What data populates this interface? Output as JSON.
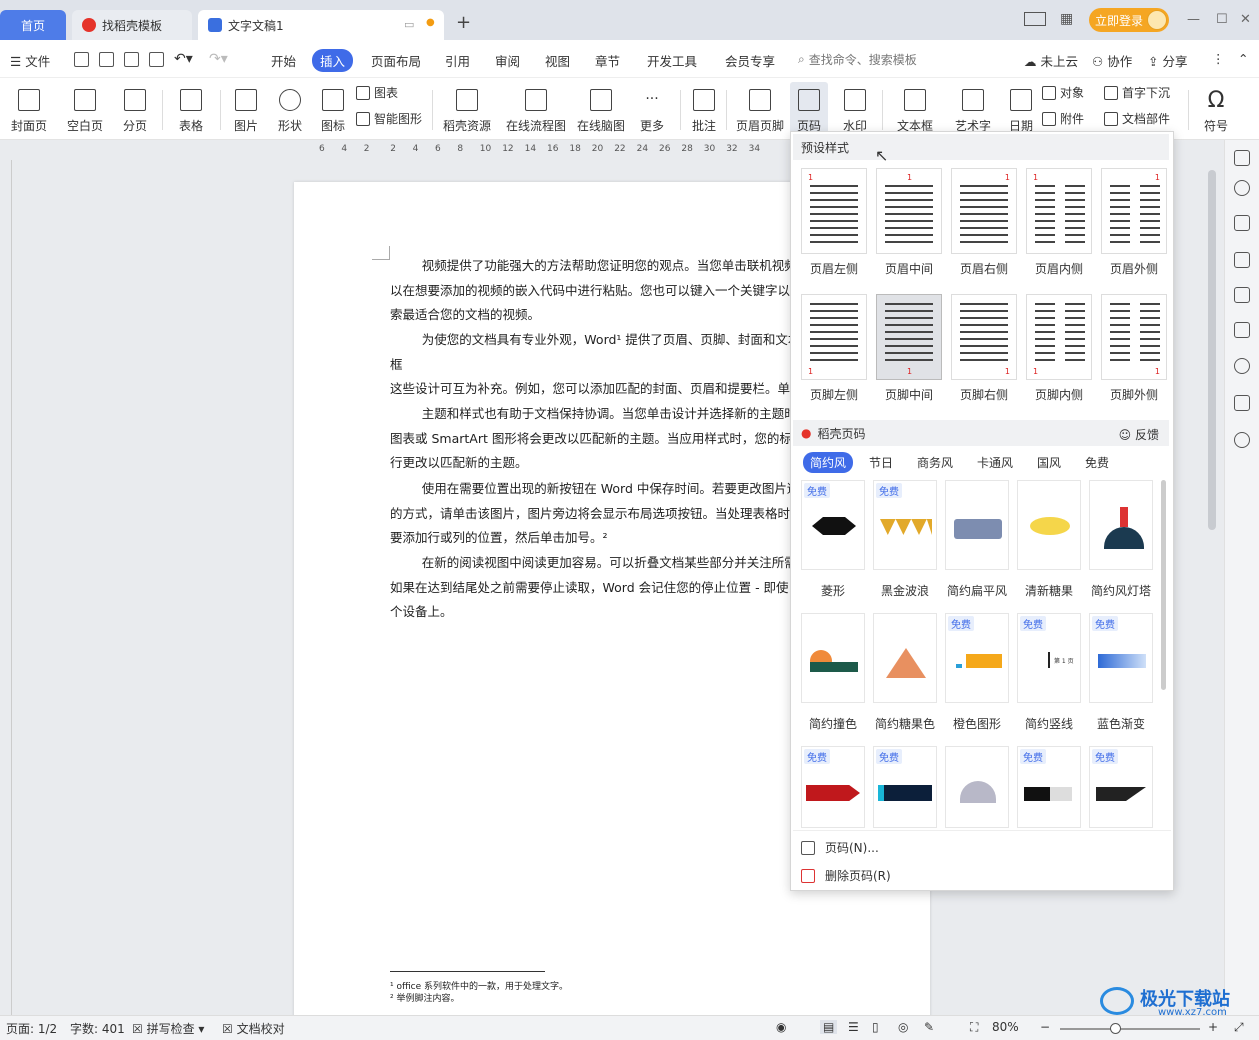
{
  "tabs": {
    "home": "首页",
    "template": "找稻壳模板",
    "doc": "文字文稿1"
  },
  "titlebar": {
    "login": "立即登录"
  },
  "menus": {
    "file": "文件",
    "items": [
      "开始",
      "插入",
      "页面布局",
      "引用",
      "审阅",
      "视图",
      "章节",
      "开发工具",
      "会员专享"
    ],
    "active": "插入",
    "search_placeholder": "查找命令、搜索模板",
    "cloud": "未上云",
    "collab": "协作",
    "share": "分享"
  },
  "toolbar": {
    "big": [
      "封面页",
      "空白页",
      "分页",
      "表格",
      "图片",
      "形状",
      "图标",
      "稻壳资源",
      "在线流程图",
      "在线脑图",
      "更多",
      "批注",
      "页眉页脚",
      "页码",
      "水印",
      "文本框",
      "艺术字",
      "日期",
      "符号"
    ],
    "small": {
      "chart": "图表",
      "smart": "智能图形",
      "object": "对象",
      "dropcap": "首字下沉",
      "attach": "附件",
      "docpart": "文档部件"
    }
  },
  "ruler": [
    "6",
    "4",
    "2",
    "2",
    "4",
    "6",
    "8",
    "10",
    "12",
    "14",
    "16",
    "18",
    "20",
    "22",
    "24",
    "26",
    "28",
    "30",
    "32",
    "34"
  ],
  "document": {
    "paragraphs": [
      "        视频提供了功能强大的方法帮助您证明您的观点。当您单击联机视频\n以在想要添加的视频的嵌入代码中进行粘贴。您也可以键入一个关键字以\n索最适合您的文档的视频。",
      "        为使您的文档具有专业外观，Word¹ 提供了页眉、页脚、封面和文本框\n这些设计可互为补充。例如，您可以添加匹配的封面、页眉和提要栏。单\n入”，然后从不同库中选择所需元素。",
      "        主题和样式也有助于文档保持协调。当您单击设计并选择新的主题时\n图表或 SmartArt 图形将会更改以匹配新的主题。当应用样式时，您的标\n行更改以匹配新的主题。",
      "        使用在需要位置出现的新按钮在 Word 中保存时间。若要更改图片适\n的方式，请单击该图片，图片旁边将会显示布局选项按钮。当处理表格时\n要添加行或列的位置，然后单击加号。²",
      "        在新的阅读视图中阅读更加容易。可以折叠文档某些部分并关注所需\n如果在达到结尾处之前需要停止读取，Word 会记住您的停止位置 - 即使\n个设备上。"
    ],
    "footnotes": [
      "¹ office 系列软件中的一款，用于处理文字。",
      "² 举例脚注内容。"
    ]
  },
  "popup": {
    "preset_title": "预设样式",
    "presets": [
      "页眉左侧",
      "页眉中间",
      "页眉右侧",
      "页眉内侧",
      "页眉外侧",
      "页脚左侧",
      "页脚中间",
      "页脚右侧",
      "页脚内侧",
      "页脚外侧"
    ],
    "preset_number": "1",
    "docer_title": "稻壳页码",
    "feedback": "反馈",
    "categories": [
      "简约风",
      "节日",
      "商务风",
      "卡通风",
      "国风",
      "免费"
    ],
    "active_category": "简约风",
    "free_badge": "免费",
    "cards": [
      "菱形",
      "黑金波浪",
      "简约扁平风",
      "清新糖果",
      "简约风灯塔",
      "简约撞色",
      "简约糖果色",
      "橙色图形",
      "简约竖线",
      "蓝色渐变"
    ],
    "card_page_text": "第 1 页",
    "actions": [
      "页码(N)...",
      "删除页码(R)"
    ]
  },
  "status": {
    "page": "页面: 1/2",
    "words": "字数: 401",
    "spell": "拼写检查",
    "proof": "文档校对",
    "zoom": "80%"
  },
  "watermark": {
    "brand": "极光下载站",
    "url": "www.xz7.com"
  },
  "colors": {
    "accent": "#3f6be8",
    "login": "#f5a623"
  }
}
